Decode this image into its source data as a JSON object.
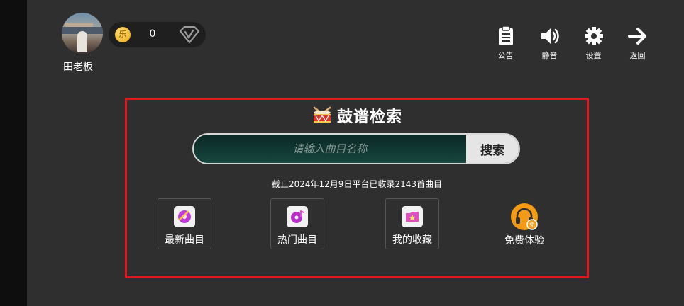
{
  "user": {
    "name": "田老板",
    "coins": "0"
  },
  "coin_glyph": "乐",
  "header_actions": [
    {
      "label": "公告",
      "icon": "clipboard-icon"
    },
    {
      "label": "静音",
      "icon": "speaker-icon"
    },
    {
      "label": "设置",
      "icon": "gear-icon"
    },
    {
      "label": "返回",
      "icon": "arrow-right-icon"
    }
  ],
  "search": {
    "title": "鼓谱检索",
    "placeholder": "请输入曲目名称",
    "button_label": "搜索",
    "count_text": "截止2024年12月9日平台已收录2143首曲目"
  },
  "categories": [
    {
      "label": "最新曲目",
      "icon": "new-songs-icon"
    },
    {
      "label": "热门曲目",
      "icon": "hot-songs-icon"
    },
    {
      "label": "我的收藏",
      "icon": "favorites-icon"
    },
    {
      "label": "免费体验",
      "icon": "headphones-free-icon",
      "badge": "免"
    }
  ],
  "colors": {
    "highlight_border": "#e0191e",
    "accent_orange": "#f39a18",
    "background": "#2f2f2f"
  }
}
